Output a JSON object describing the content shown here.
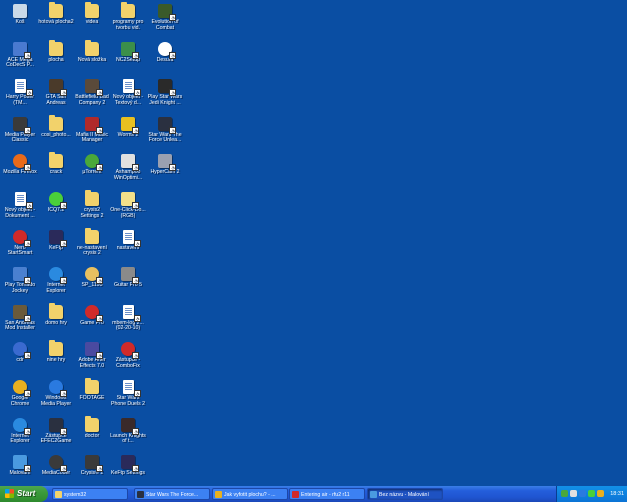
{
  "desktop": {
    "icons": [
      {
        "label": "Koš",
        "color": "#c9d9e8",
        "shape": "sq",
        "icon": "recycle-bin-icon"
      },
      {
        "label": "hotová plocha2",
        "color": "#f2d26b",
        "shape": "folder",
        "icon": "folder-icon"
      },
      {
        "label": "videa",
        "color": "#f2d26b",
        "shape": "folder",
        "icon": "folder-icon"
      },
      {
        "label": "programy pro tvorbu vid.",
        "color": "#f2d26b",
        "shape": "folder",
        "icon": "folder-icon"
      },
      {
        "label": "Evolution of Combat",
        "color": "#3a5a2a",
        "shape": "sq",
        "icon": "game-icon"
      },
      {
        "label": "ACE Mega CoDecS P...",
        "color": "#4a7ad0",
        "shape": "sq",
        "icon": "codec-icon"
      },
      {
        "label": "plocha",
        "color": "#f2d26b",
        "shape": "folder",
        "icon": "folder-icon"
      },
      {
        "label": "Nová složka",
        "color": "#f2d26b",
        "shape": "folder",
        "icon": "folder-icon"
      },
      {
        "label": "NC2Setup",
        "color": "#3b8f4a",
        "shape": "sq",
        "icon": "setup-icon"
      },
      {
        "label": "Desura",
        "color": "#ffffff",
        "shape": "round",
        "icon": "desura-icon"
      },
      {
        "label": "Harry Potter (TM...",
        "color": "#ffffff",
        "shape": "doc",
        "icon": "document-icon"
      },
      {
        "label": "GTA San Andreas",
        "color": "#4a3a2a",
        "shape": "sq",
        "icon": "game-icon"
      },
      {
        "label": "Battlefield Bad Company 2",
        "color": "#5a4a3a",
        "shape": "sq",
        "icon": "game-icon"
      },
      {
        "label": "Nový objekt - Textový d...",
        "color": "#ffffff",
        "shape": "doc",
        "icon": "document-icon"
      },
      {
        "label": "Play Star Wars Jedi Knight ...",
        "color": "#2a2a2a",
        "shape": "sq",
        "icon": "game-icon"
      },
      {
        "label": "Media Player Classic",
        "color": "#3a3a3a",
        "shape": "sq",
        "icon": "media-player-icon"
      },
      {
        "label": "cosi_photo...",
        "color": "#f2d26b",
        "shape": "folder",
        "icon": "folder-icon"
      },
      {
        "label": "Mafia II Music Manager",
        "color": "#b02a2a",
        "shape": "sq",
        "icon": "music-icon"
      },
      {
        "label": "Worms 2",
        "color": "#e8c020",
        "shape": "sq",
        "icon": "game-icon"
      },
      {
        "label": "Star Wars The Force Unlea...",
        "color": "#2a3040",
        "shape": "sq",
        "icon": "game-icon"
      },
      {
        "label": "Mozilla Firefox",
        "color": "#e86a1a",
        "shape": "round",
        "icon": "firefox-icon"
      },
      {
        "label": "crack",
        "color": "#f2d26b",
        "shape": "folder",
        "icon": "folder-icon"
      },
      {
        "label": "µTorrent",
        "color": "#4aa83a",
        "shape": "round",
        "icon": "utorrent-icon"
      },
      {
        "label": "Ashampoo WinOptimi...",
        "color": "#e0e0e0",
        "shape": "sq",
        "icon": "app-icon"
      },
      {
        "label": "HyperCam 2",
        "color": "#9aa0b0",
        "shape": "sq",
        "icon": "camera-icon"
      },
      {
        "label": "Nový objekt - Dokument ...",
        "color": "#ffffff",
        "shape": "doc",
        "icon": "document-icon"
      },
      {
        "label": "ICQ7.2",
        "color": "#4ad03a",
        "shape": "round",
        "icon": "icq-icon"
      },
      {
        "label": "crysis2 Settings 2",
        "color": "#f2d26b",
        "shape": "folder",
        "icon": "folder-icon"
      },
      {
        "label": "One-Click-Do... (RGB)",
        "color": "#f2e08a",
        "shape": "sq",
        "icon": "app-icon"
      },
      null,
      {
        "label": "Nero StartSmart",
        "color": "#d02a2a",
        "shape": "round",
        "icon": "nero-icon"
      },
      {
        "label": "KeFtp",
        "color": "#2a2a5a",
        "shape": "sq",
        "icon": "ftp-icon"
      },
      {
        "label": "ne-nastavení crysis 2",
        "color": "#f2d26b",
        "shape": "folder",
        "icon": "folder-icon"
      },
      {
        "label": "nastavení",
        "color": "#ffffff",
        "shape": "doc",
        "icon": "document-icon"
      },
      null,
      {
        "label": "Play Tornado Jockey",
        "color": "#4a80d0",
        "shape": "sq",
        "icon": "game-icon"
      },
      {
        "label": "Internet Explorer",
        "color": "#2a8ae0",
        "shape": "round",
        "icon": "internet-explorer-icon"
      },
      {
        "label": "SP_1195",
        "color": "#e8c060",
        "shape": "round",
        "icon": "app-icon"
      },
      {
        "label": "Guitar Pro 5",
        "color": "#8a8a8a",
        "shape": "sq",
        "icon": "guitar-pro-icon"
      },
      null,
      {
        "label": "San Andreas Mod Installer",
        "color": "#6a5a3a",
        "shape": "sq",
        "icon": "installer-icon"
      },
      {
        "label": "domo hry",
        "color": "#f2d26b",
        "shape": "folder",
        "icon": "folder-icon"
      },
      {
        "label": "Game Pro",
        "color": "#d02a2a",
        "shape": "round",
        "icon": "game-icon"
      },
      {
        "label": "mbem-log 2... (02-20-10)",
        "color": "#ffffff",
        "shape": "doc",
        "icon": "document-icon"
      },
      null,
      {
        "label": "cdr",
        "color": "#3a6ad0",
        "shape": "round",
        "icon": "cd-icon"
      },
      {
        "label": "nine hry",
        "color": "#f2d26b",
        "shape": "folder",
        "icon": "folder-icon"
      },
      {
        "label": "Adobe After Effects 7.0",
        "color": "#4a4aa0",
        "shape": "sq",
        "icon": "after-effects-icon"
      },
      {
        "label": "Zástupce - ComboFix",
        "color": "#d02a2a",
        "shape": "round",
        "icon": "combofix-icon"
      },
      null,
      {
        "label": "Google Chrome",
        "color": "#e8b020",
        "shape": "round",
        "icon": "chrome-icon"
      },
      {
        "label": "Windows Media Player",
        "color": "#2a7ae0",
        "shape": "round",
        "icon": "media-player-icon"
      },
      {
        "label": "FOOTAGE",
        "color": "#f2d26b",
        "shape": "folder",
        "icon": "folder-icon"
      },
      {
        "label": "Star Wars Phone Duels 2",
        "color": "#ffffff",
        "shape": "doc",
        "icon": "document-icon"
      },
      null,
      {
        "label": "Internet Explorer",
        "color": "#2a8ae0",
        "shape": "round",
        "icon": "internet-explorer-icon"
      },
      {
        "label": "Zástupce EFEC2Game",
        "color": "#2a3040",
        "shape": "sq",
        "icon": "game-icon"
      },
      {
        "label": "doctor",
        "color": "#f2d26b",
        "shape": "folder",
        "icon": "folder-icon"
      },
      {
        "label": "Launch Knights of t...",
        "color": "#3a2a2a",
        "shape": "sq",
        "icon": "game-icon"
      },
      null,
      {
        "label": "Malování",
        "color": "#4a9ae0",
        "shape": "sq",
        "icon": "paint-icon"
      },
      {
        "label": "MediaCoder",
        "color": "#3a3a3a",
        "shape": "round",
        "icon": "mediacoder-icon"
      },
      {
        "label": "Crysis® 2",
        "color": "#3a3a3a",
        "shape": "sq",
        "icon": "game-icon"
      },
      {
        "label": "KeFtp Settings",
        "color": "#2a2a5a",
        "shape": "sq",
        "icon": "ftp-icon"
      },
      null
    ]
  },
  "taskbar": {
    "start_label": "Start",
    "tasks": [
      {
        "label": "system32",
        "color": "#f2d26b",
        "active": false
      },
      {
        "label": "Star Wars The Force...",
        "color": "#2a3040",
        "active": false
      },
      {
        "label": "Jak vyfotit plochu? - ...",
        "color": "#e8b020",
        "active": false
      },
      {
        "label": "Entering air - rfu2 r11",
        "color": "#d02a2a",
        "active": false
      },
      {
        "label": "Bez názvu - Malování",
        "color": "#4a9ae0",
        "active": true
      }
    ],
    "clock": "18:31",
    "tray_colors": [
      "#4aa83a",
      "#e0e0e0",
      "#2a7ae0",
      "#4ad03a",
      "#e8b020"
    ]
  }
}
